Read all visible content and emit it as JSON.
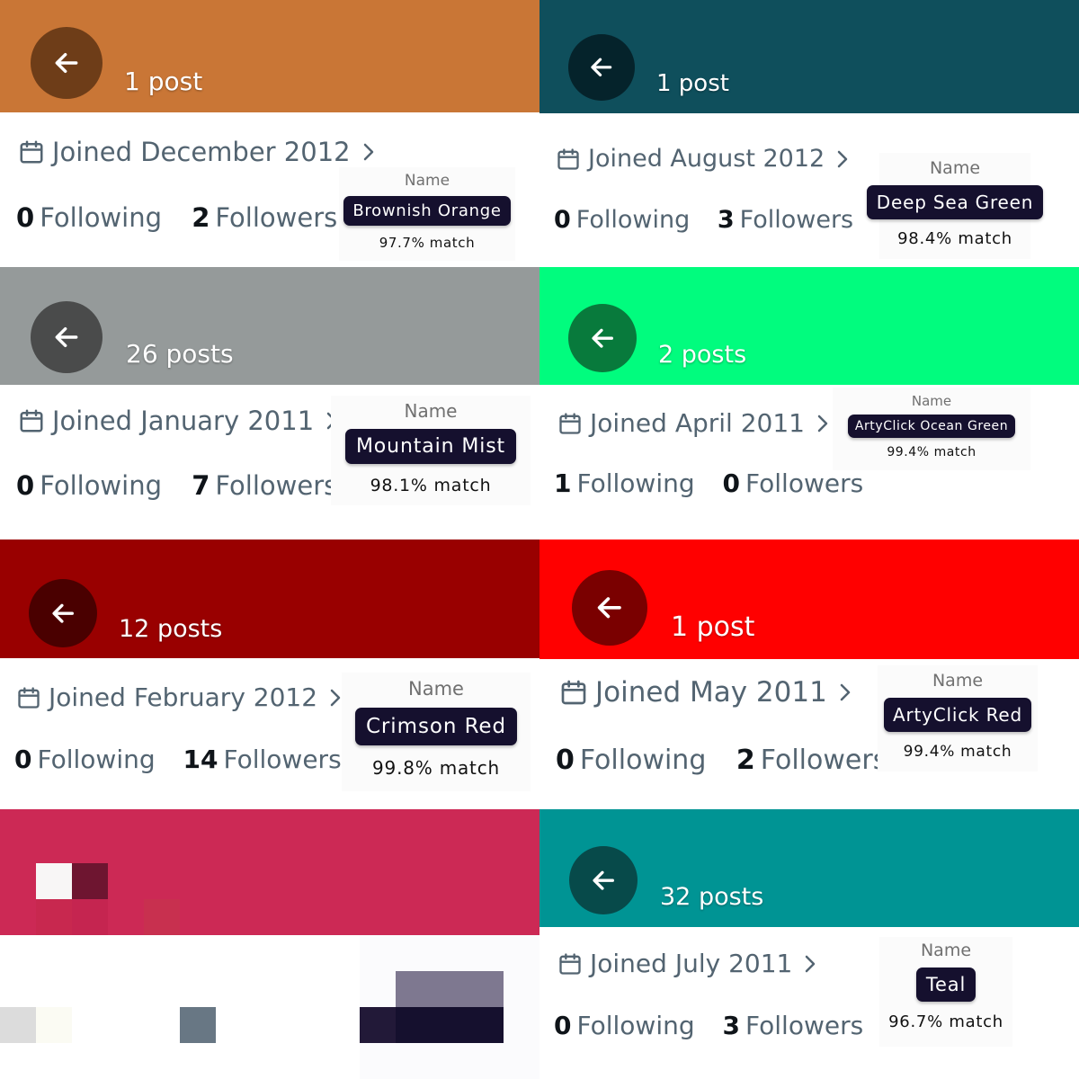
{
  "name_label": "Name",
  "icons": {
    "back": "arrow-left-icon",
    "calendar": "calendar-icon",
    "chevron": "chevron-right-icon"
  },
  "tiles": [
    {
      "banner_color": "#c97636",
      "button_color": "#6e3d18",
      "posts": "1 post",
      "joined": "Joined December 2012",
      "following_count": "0",
      "following_label": "Following",
      "followers_count": "2",
      "followers_label": "Followers",
      "color_name": "Brownish Orange",
      "match": "97.7% match"
    },
    {
      "banner_color": "#0f4f5c",
      "button_color": "#05232b",
      "posts": "1 post",
      "joined": "Joined August 2012",
      "following_count": "0",
      "following_label": "Following",
      "followers_count": "3",
      "followers_label": "Followers",
      "color_name": "Deep Sea Green",
      "match": "98.4% match"
    },
    {
      "banner_color": "#959a9a",
      "button_color": "#4a4b4b",
      "posts": "26 posts",
      "joined": "Joined January 2011",
      "following_count": "0",
      "following_label": "Following",
      "followers_count": "7",
      "followers_label": "Followers",
      "color_name": "Mountain Mist",
      "match": "98.1% match"
    },
    {
      "banner_color": "#01fc7e",
      "button_color": "#087a3c",
      "posts": "2 posts",
      "joined": "Joined April 2011",
      "following_count": "1",
      "following_label": "Following",
      "followers_count": "0",
      "followers_label": "Followers",
      "color_name": "ArtyClick Ocean Green",
      "match": "99.4% match"
    },
    {
      "banner_color": "#990000",
      "button_color": "#4a0000",
      "posts": "12 posts",
      "joined": "Joined February 2012",
      "following_count": "0",
      "following_label": "Following",
      "followers_count": "14",
      "followers_label": "Followers",
      "color_name": "Crimson Red",
      "match": "99.8% match"
    },
    {
      "banner_color": "#ff0000",
      "button_color": "#7a0000",
      "posts": "1 post",
      "joined": "Joined May 2011",
      "following_count": "0",
      "following_label": "Following",
      "followers_count": "2",
      "followers_label": "Followers",
      "color_name": "ArtyClick Red",
      "match": "99.4% match"
    },
    {
      "banner_color": "#cc2955",
      "pixelated": true
    },
    {
      "banner_color": "#009494",
      "button_color": "#074a4a",
      "posts": "32 posts",
      "joined": "Joined July 2011",
      "following_count": "0",
      "following_label": "Following",
      "followers_count": "3",
      "followers_label": "Followers",
      "color_name": "Teal",
      "match": "96.7% match"
    }
  ]
}
